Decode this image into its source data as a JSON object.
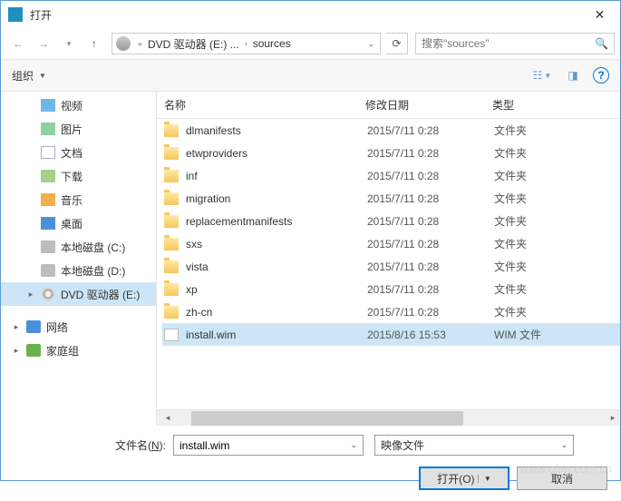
{
  "title": "打开",
  "breadcrumb": {
    "item1": "DVD 驱动器 (E:) ...",
    "item2": "sources"
  },
  "search": {
    "placeholder": "搜索\"sources\""
  },
  "toolbar": {
    "organize": "组织"
  },
  "columns": {
    "name": "名称",
    "date": "修改日期",
    "type": "类型"
  },
  "sidebar": {
    "items": [
      {
        "label": "视频",
        "iconClass": "ico-video"
      },
      {
        "label": "图片",
        "iconClass": "ico-pic"
      },
      {
        "label": "文档",
        "iconClass": "ico-doc"
      },
      {
        "label": "下载",
        "iconClass": "ico-down"
      },
      {
        "label": "音乐",
        "iconClass": "ico-music"
      },
      {
        "label": "桌面",
        "iconClass": "ico-desk"
      },
      {
        "label": "本地磁盘 (C:)",
        "iconClass": "ico-disk"
      },
      {
        "label": "本地磁盘 (D:)",
        "iconClass": "ico-disk"
      },
      {
        "label": "DVD 驱动器 (E:)",
        "iconClass": "ico-dvd",
        "selected": true
      }
    ],
    "bottom": [
      {
        "label": "网络",
        "iconClass": "ico-net"
      },
      {
        "label": "家庭组",
        "iconClass": "ico-home"
      }
    ]
  },
  "files": [
    {
      "name": "dlmanifests",
      "date": "2015/7/11 0:28",
      "type": "文件夹",
      "icon": "ico-folder"
    },
    {
      "name": "etwproviders",
      "date": "2015/7/11 0:28",
      "type": "文件夹",
      "icon": "ico-folder"
    },
    {
      "name": "inf",
      "date": "2015/7/11 0:28",
      "type": "文件夹",
      "icon": "ico-folder"
    },
    {
      "name": "migration",
      "date": "2015/7/11 0:28",
      "type": "文件夹",
      "icon": "ico-folder"
    },
    {
      "name": "replacementmanifests",
      "date": "2015/7/11 0:28",
      "type": "文件夹",
      "icon": "ico-folder"
    },
    {
      "name": "sxs",
      "date": "2015/7/11 0:28",
      "type": "文件夹",
      "icon": "ico-folder"
    },
    {
      "name": "vista",
      "date": "2015/7/11 0:28",
      "type": "文件夹",
      "icon": "ico-folder"
    },
    {
      "name": "xp",
      "date": "2015/7/11 0:28",
      "type": "文件夹",
      "icon": "ico-folder"
    },
    {
      "name": "zh-cn",
      "date": "2015/7/11 0:28",
      "type": "文件夹",
      "icon": "ico-folder"
    },
    {
      "name": "install.wim",
      "date": "2015/8/16 15:53",
      "type": "WIM 文件",
      "icon": "ico-file",
      "selected": true
    }
  ],
  "footer": {
    "filename_label_pre": "文件名(",
    "filename_label_u": "N",
    "filename_label_post": "):",
    "filename_value": "install.wim",
    "filter": "映像文件",
    "open_label": "打开(O)",
    "cancel_label": "取消"
  },
  "watermark": "www.cfan.com.cn"
}
